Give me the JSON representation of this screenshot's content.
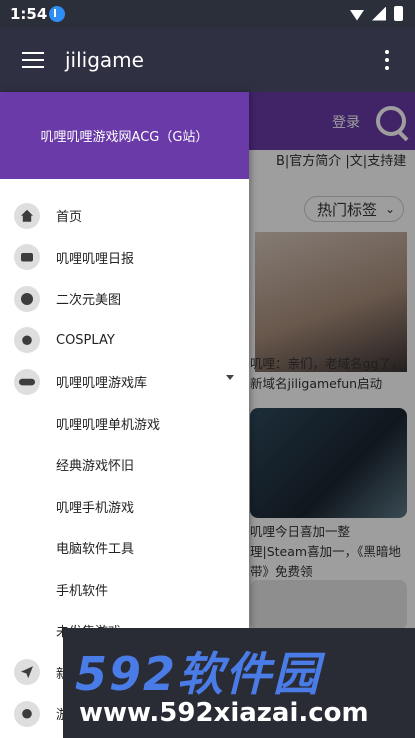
{
  "status_bar": {
    "time": "1:54"
  },
  "app_bar": {
    "title": "jiligame"
  },
  "background": {
    "login_label": "登录",
    "ticker_text": "B|官方简介 |文|支持建",
    "dropdown_label": "热门标签",
    "card1_caption": "叽哩：亲们，老域名gg了，新域名jiligamefun启动",
    "card2_caption": "叽哩今日喜加一整理|Steam喜加一，《黑暗地带》免费领"
  },
  "drawer": {
    "site_title": "叽哩叽哩游戏网ACG（G站）",
    "items": [
      {
        "label": "首页",
        "icon": "home-icon"
      },
      {
        "label": "叽哩叽哩日报",
        "icon": "newspaper-icon"
      },
      {
        "label": "二次元美图",
        "icon": "x-circle-icon"
      },
      {
        "label": "COSPLAY",
        "icon": "gender-icon"
      },
      {
        "label": "叽哩叽哩游戏库",
        "icon": "gamepad-icon"
      }
    ],
    "sub_items": [
      {
        "label": "叽哩叽哩单机游戏"
      },
      {
        "label": "经典游戏怀旧"
      },
      {
        "label": "叽哩手机游戏"
      },
      {
        "label": "电脑软件工具"
      },
      {
        "label": "手机软件"
      },
      {
        "label": "未发售游戏"
      }
    ],
    "bottom_items": [
      {
        "label": "新",
        "icon": "send-icon"
      },
      {
        "label": "游",
        "icon": "gender-icon"
      }
    ]
  },
  "watermark": {
    "logo": "592软件园",
    "url": "www.592xiazai.com"
  }
}
